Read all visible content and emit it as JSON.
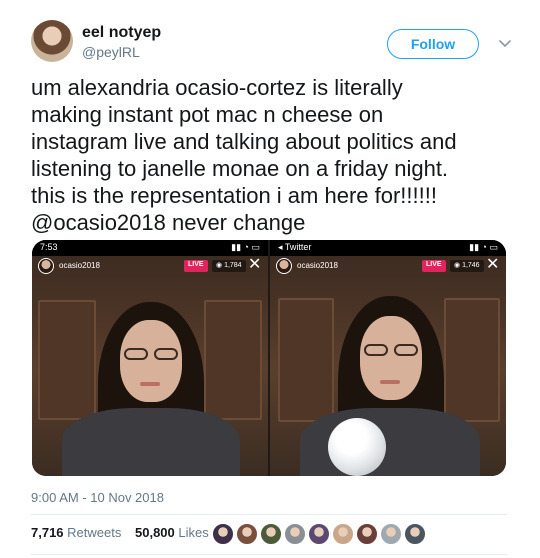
{
  "author": {
    "display_name": "eel notyep",
    "handle": "@peylRL"
  },
  "follow_label": "Follow",
  "tweet_text": "um alexandria ocasio-cortez is literally\nmaking instant pot mac n cheese on\ninstagram live and talking about politics and\nlistening to janelle monae on a friday night.\nthis is the representation i am here for!!!!!!\n@ocasio2018 never change",
  "media": {
    "left": {
      "status_time": "7:53",
      "account": "ocasio2018",
      "live_label": "LIVE",
      "viewers": "1,784"
    },
    "right": {
      "status_back": "◂ Twitter",
      "account": "ocasio2018",
      "live_label": "LIVE",
      "viewers": "1,746"
    }
  },
  "timestamp": "9:00 AM - 10 Nov 2018",
  "stats": {
    "retweets_count": "7,716",
    "retweets_label": "Retweets",
    "likes_count": "50,800",
    "likes_label": "Likes"
  },
  "colors": {
    "accent": "#1da1f2",
    "live": "#e0245e",
    "muted": "#657786"
  },
  "liker_colors": [
    "#3c3148",
    "#7a4f3e",
    "#4c5b3a",
    "#8a8f96",
    "#5a4a70",
    "#c9a58a",
    "#6a3f3a",
    "#a0a8b0",
    "#4b5560"
  ]
}
